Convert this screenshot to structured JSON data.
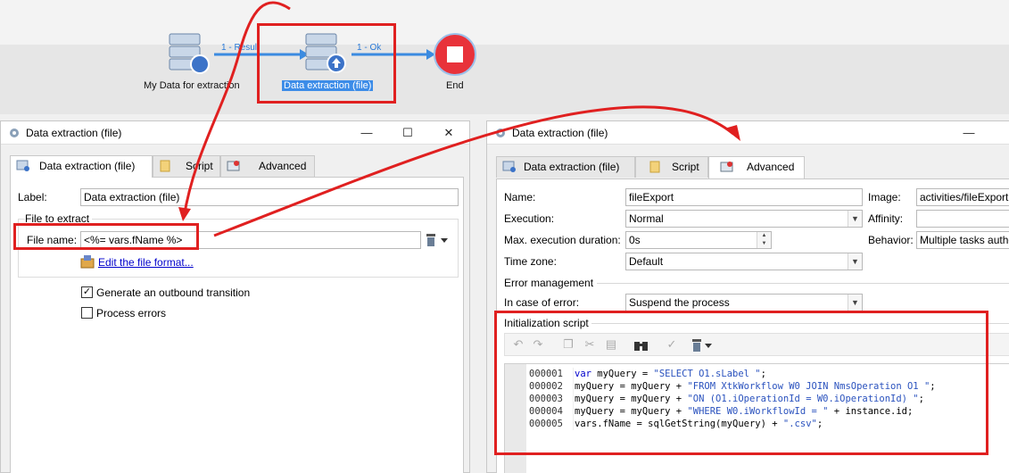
{
  "workflow": {
    "nodes": {
      "source": "My Data for extraction",
      "extraction": "Data extraction (file)",
      "end": "End"
    },
    "transitions": {
      "t1": "1 - Result",
      "t2": "1 - Ok"
    }
  },
  "left_window": {
    "title": "Data extraction (file)",
    "controls": {
      "minimize": "—",
      "maximize": "☐",
      "close": "✕"
    },
    "tabs": [
      "Data extraction (file)",
      "Script",
      "Advanced"
    ],
    "label_caption": "Label:",
    "label_value": "Data extraction (file)",
    "group_title": "File to extract",
    "file_name_caption": "File name:",
    "file_name_value": "<%= vars.fName %>",
    "edit_link": "Edit the file format...",
    "generate_outbound": "Generate an outbound transition",
    "generate_outbound_checked": true,
    "process_errors": "Process errors",
    "process_errors_checked": false
  },
  "right_window": {
    "title": "Data extraction (file)",
    "tabs": [
      "Data extraction (file)",
      "Script",
      "Advanced"
    ],
    "active_tab": "Advanced",
    "name_caption": "Name:",
    "name_value": "fileExport",
    "image_caption": "Image:",
    "image_value": "activities/fileExport.",
    "execution_caption": "Execution:",
    "execution_value": "Normal",
    "affinity_caption": "Affinity:",
    "affinity_value": "",
    "max_duration_caption": "Max. execution duration:",
    "max_duration_value": "0s",
    "behavior_caption": "Behavior:",
    "behavior_value": "Multiple tasks autho",
    "timezone_caption": "Time zone:",
    "timezone_value": "Default",
    "error_mgmt_title": "Error management",
    "in_case_error_caption": "In case of error:",
    "in_case_error_value": "Suspend the process",
    "init_script_title": "Initialization script",
    "line_numbers": [
      "000001",
      "000002",
      "000003",
      "000004",
      "000005"
    ],
    "code": [
      [
        {
          "t": "kw",
          "v": "var"
        },
        {
          "t": "pl",
          "v": " myQuery = "
        },
        {
          "t": "st",
          "v": "\"SELECT O1.sLabel \""
        },
        {
          "t": "pl",
          "v": ";"
        }
      ],
      [
        {
          "t": "pl",
          "v": "myQuery = myQuery + "
        },
        {
          "t": "st",
          "v": "\"FROM XtkWorkflow W0 JOIN NmsOperation O1 \""
        },
        {
          "t": "pl",
          "v": ";"
        }
      ],
      [
        {
          "t": "pl",
          "v": "myQuery = myQuery + "
        },
        {
          "t": "st",
          "v": "\"ON (O1.iOperationId = W0.iOperationId) \""
        },
        {
          "t": "pl",
          "v": ";"
        }
      ],
      [
        {
          "t": "pl",
          "v": "myQuery = myQuery + "
        },
        {
          "t": "st",
          "v": "\"WHERE W0.iWorkflowId = \""
        },
        {
          "t": "pl",
          "v": " + instance.id;"
        }
      ],
      [
        {
          "t": "pl",
          "v": "vars.fName = sqlGetString(myQuery) + "
        },
        {
          "t": "st",
          "v": "\".csv\""
        },
        {
          "t": "pl",
          "v": ";"
        }
      ]
    ]
  },
  "colors": {
    "highlight_red": "#e02020",
    "code_keyword": "#0000cc",
    "code_string": "#2a52be",
    "link": "#0000cc",
    "selection": "#3c8ce8"
  }
}
